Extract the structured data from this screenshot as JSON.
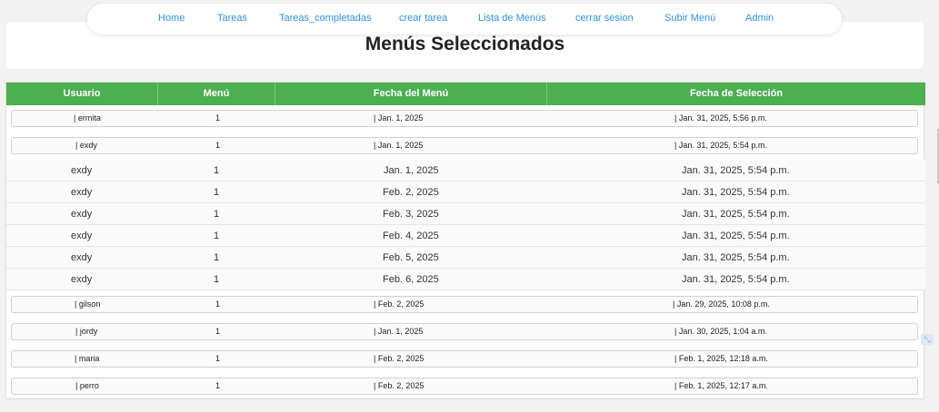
{
  "nav": {
    "links": [
      "Home",
      "Tareas",
      "Tareas_completadas",
      "crear tarea",
      "Lista de Menús",
      "cerrar sesion",
      "Subir Menú",
      "Admin"
    ]
  },
  "page_title": "Menús Seleccionados",
  "table": {
    "headers": [
      "Usuario",
      "Menú",
      "Fecha del Menú",
      "Fecha de Selección"
    ],
    "card_rows_top": [
      {
        "usuario": "| ermita",
        "menu": "1",
        "fecha_menu": "| Jan. 1, 2025",
        "fecha_sel": "| Jan. 31, 2025, 5:56 p.m."
      },
      {
        "usuario": "| exdy",
        "menu": "1",
        "fecha_menu": "| Jan. 1, 2025",
        "fecha_sel": "| Jan. 31, 2025, 5:54 p.m."
      }
    ],
    "plain_rows": [
      {
        "usuario": "exdy",
        "menu": "1",
        "fecha_menu": "Jan. 1, 2025",
        "fecha_sel": "Jan. 31, 2025, 5:54 p.m."
      },
      {
        "usuario": "exdy",
        "menu": "1",
        "fecha_menu": "Feb. 2, 2025",
        "fecha_sel": "Jan. 31, 2025, 5:54 p.m."
      },
      {
        "usuario": "exdy",
        "menu": "1",
        "fecha_menu": "Feb. 3, 2025",
        "fecha_sel": "Jan. 31, 2025, 5:54 p.m."
      },
      {
        "usuario": "exdy",
        "menu": "1",
        "fecha_menu": "Feb. 4, 2025",
        "fecha_sel": "Jan. 31, 2025, 5:54 p.m."
      },
      {
        "usuario": "exdy",
        "menu": "1",
        "fecha_menu": "Feb. 5, 2025",
        "fecha_sel": "Jan. 31, 2025, 5:54 p.m."
      },
      {
        "usuario": "exdy",
        "menu": "1",
        "fecha_menu": "Feb. 6, 2025",
        "fecha_sel": "Jan. 31, 2025, 5:54 p.m."
      }
    ],
    "card_rows_bottom": [
      {
        "usuario": "| gilson",
        "menu": "1",
        "fecha_menu": "| Feb. 2, 2025",
        "fecha_sel": "| Jan. 29, 2025, 10:08 p.m."
      },
      {
        "usuario": "| jordy",
        "menu": "1",
        "fecha_menu": "| Jan. 1, 2025",
        "fecha_sel": "| Jan. 30, 2025, 1:04 a.m."
      },
      {
        "usuario": "| maria",
        "menu": "1",
        "fecha_menu": "| Feb. 2, 2025",
        "fecha_sel": "| Feb. 1, 2025, 12:18 a.m."
      },
      {
        "usuario": "| perro",
        "menu": "1",
        "fecha_menu": "| Feb. 2, 2025",
        "fecha_sel": "| Feb. 1, 2025, 12:17 a.m."
      }
    ]
  },
  "colors": {
    "header_green": "#4caf50",
    "link_blue": "#2f8fe0"
  },
  "icons": {
    "corner": "collapse-arrows-icon"
  }
}
